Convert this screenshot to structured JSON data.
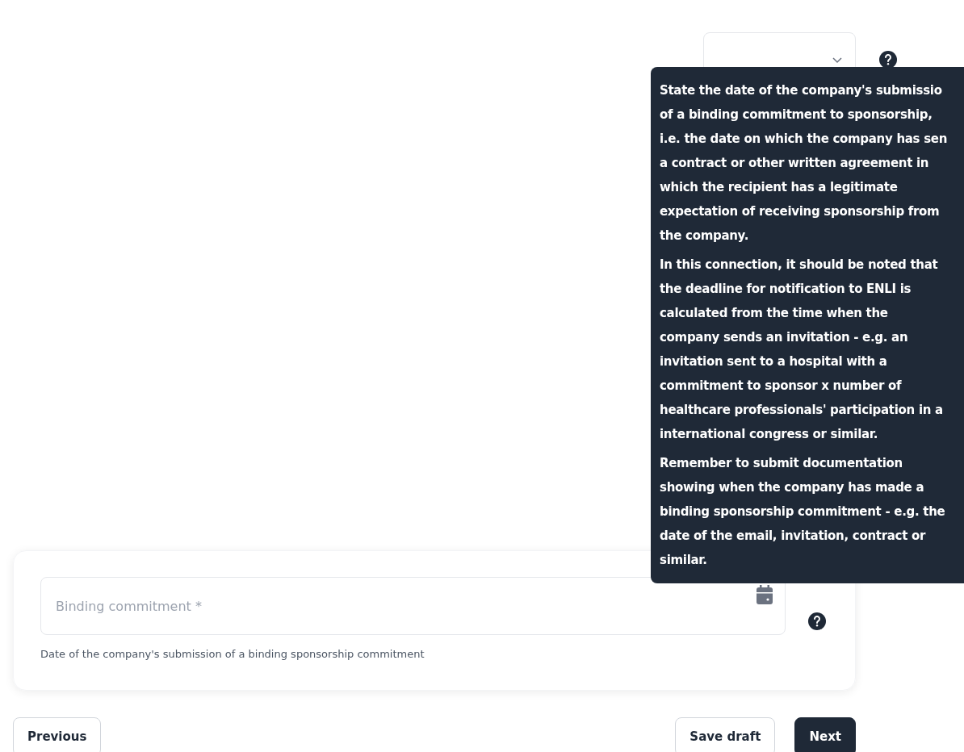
{
  "select_field": {
    "expanded": false
  },
  "tooltip": {
    "paragraphs": [
      [
        "State the date of the company's submissio",
        "of a binding commitment to sponsorship,",
        "i.e. the date on which the company has sen",
        "a contract or other written agreement in",
        "which the recipient has a legitimate",
        "expectation of receiving sponsorship from",
        "the company."
      ],
      [
        "In this connection, it should be noted that",
        "the deadline for notification to ENLI is",
        "calculated from the time when the",
        "company sends an invitation - e.g. an",
        "invitation sent to a hospital with a",
        "commitment to sponsor x number of",
        "healthcare professionals' participation in a",
        "international congress or similar."
      ],
      [
        "Remember to submit documentation",
        "showing when the company has made a",
        "binding sponsorship commitment - e.g. the",
        "date of the email, invitation, contract or",
        "similar."
      ]
    ]
  },
  "date_field": {
    "placeholder": "Binding commitment *",
    "helper": "Date of the company's submission of a binding sponsorship commitment"
  },
  "buttons": [
    {
      "label": "Previous",
      "kind": "secondary"
    },
    {
      "label": "Save draft",
      "kind": "secondary"
    },
    {
      "label": "Next",
      "kind": "primary"
    }
  ]
}
